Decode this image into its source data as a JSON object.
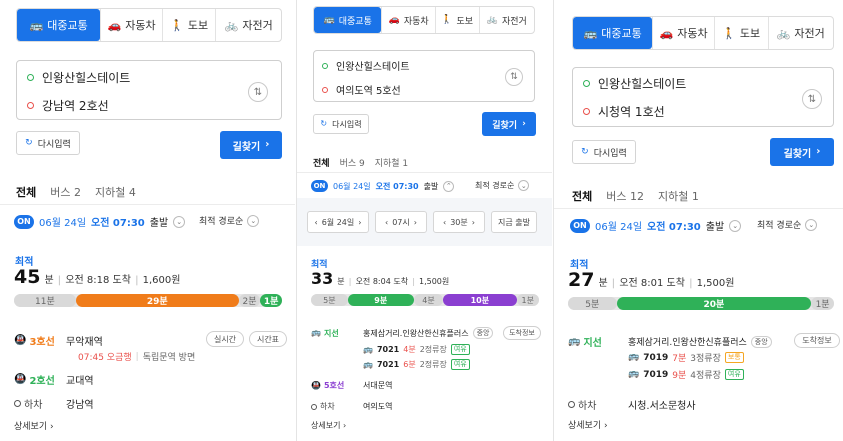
{
  "colors": {
    "accent": "#1a73e8",
    "line3": "#f07c1a",
    "line2": "#2fb158",
    "line5": "#8b3fd1",
    "bus_green": "#2fb158",
    "walk": "#d9d9d9"
  },
  "panels": [
    {
      "modes": [
        {
          "icon": "bus-icon",
          "glyph": "🚌",
          "label": "대중교통"
        },
        {
          "icon": "car-icon",
          "glyph": "🚗",
          "label": "자동차"
        },
        {
          "icon": "walk-icon",
          "glyph": "🚶",
          "label": "도보"
        },
        {
          "icon": "bike-icon",
          "glyph": "🚲",
          "label": "자전거"
        }
      ],
      "origin": "인왕산힐스테이트",
      "destination": "강남역 2호선",
      "reset_label": "다시입력",
      "search_label": "길찾기",
      "tabs": [
        "전체",
        "버스 2",
        "지하철 4"
      ],
      "on_badge": "ON",
      "date": "06월 24일",
      "time": "오전 07:30",
      "depart": "출발",
      "sort": "최적 경로순",
      "fastest": "최적",
      "minutes": "45",
      "unit": "분",
      "arrive": "오전 8:18 도착",
      "fare": "1,600원",
      "bar": [
        {
          "kind": "walk",
          "label": "11분",
          "value": 11
        },
        {
          "kind": "line3",
          "label": "29분",
          "value": 29
        },
        {
          "kind": "walk",
          "label": "2분",
          "value": 2
        },
        {
          "kind": "line2",
          "label": "1분",
          "value": 1
        }
      ],
      "steps": [
        {
          "tag": "3호선",
          "color": "line3",
          "stop": "무악재역",
          "buttons": [
            "실시간",
            "시간표"
          ]
        },
        {
          "tag": "2호선",
          "color": "line2",
          "stop": "교대역"
        },
        {
          "tag": "하차",
          "color": "",
          "stop": "강남역"
        }
      ],
      "step1_sub_time": "07:45 오금행",
      "step1_sub_dir": "독립문역 방면",
      "more": "상세보기"
    },
    {
      "modes": [
        {
          "icon": "bus-icon",
          "glyph": "🚌",
          "label": "대중교통"
        },
        {
          "icon": "car-icon",
          "glyph": "🚗",
          "label": "자동차"
        },
        {
          "icon": "walk-icon",
          "glyph": "🚶",
          "label": "도보"
        },
        {
          "icon": "bike-icon",
          "glyph": "🚲",
          "label": "자전거"
        }
      ],
      "origin": "인왕산힐스테이트",
      "destination": "여의도역 5호선",
      "reset_label": "다시입력",
      "search_label": "길찾기",
      "tabs": [
        "전체",
        "버스 9",
        "지하철 1"
      ],
      "on_badge": "ON",
      "date": "06월 24일",
      "time": "오전 07:30",
      "depart": "출발",
      "sort": "최적 경로순",
      "timebar": [
        "6월 24일",
        "07시",
        "30분"
      ],
      "now_depart": "지금 출발",
      "fastest": "최적",
      "minutes": "33",
      "unit": "분",
      "arrive": "오전 8:04 도착",
      "fare": "1,500원",
      "bar": [
        {
          "kind": "walk",
          "label": "5분",
          "value": 5
        },
        {
          "kind": "bus_green",
          "label": "9분",
          "value": 9
        },
        {
          "kind": "walk",
          "label": "4분",
          "value": 4
        },
        {
          "kind": "line5",
          "label": "10분",
          "value": 10
        },
        {
          "kind": "walk",
          "label": "1분",
          "value": 1
        }
      ],
      "bus_stop": "홍제삼거리.인왕산한신휴플러스",
      "stop_badge": "중앙",
      "stop_info": "도착정보",
      "buses": [
        {
          "no": "7021",
          "min": "4분",
          "stops": "2정류장",
          "status": "여유"
        },
        {
          "no": "7021",
          "min": "6분",
          "stops": "2정류장",
          "status": "여유"
        }
      ],
      "bus_tag": "지선",
      "steps2": [
        {
          "tag": "5호선",
          "color": "line5",
          "stop": "서대문역"
        },
        {
          "tag": "하차",
          "color": "",
          "stop": "여의도역"
        }
      ],
      "more": "상세보기"
    },
    {
      "modes": [
        {
          "icon": "bus-icon",
          "glyph": "🚌",
          "label": "대중교통"
        },
        {
          "icon": "car-icon",
          "glyph": "🚗",
          "label": "자동차"
        },
        {
          "icon": "walk-icon",
          "glyph": "🚶",
          "label": "도보"
        },
        {
          "icon": "bike-icon",
          "glyph": "🚲",
          "label": "자전거"
        }
      ],
      "origin": "인왕산힐스테이트",
      "destination": "시청역 1호선",
      "reset_label": "다시입력",
      "search_label": "길찾기",
      "tabs": [
        "전체",
        "버스 12",
        "지하철 1"
      ],
      "on_badge": "ON",
      "date": "06월 24일",
      "time": "오전 07:30",
      "depart": "출발",
      "sort": "최적 경로순",
      "fastest": "최적",
      "minutes": "27",
      "unit": "분",
      "arrive": "오전 8:01 도착",
      "fare": "1,500원",
      "bar": [
        {
          "kind": "walk",
          "label": "5분",
          "value": 5
        },
        {
          "kind": "bus_green",
          "label": "20분",
          "value": 20
        },
        {
          "kind": "walk",
          "label": "1분",
          "value": 1
        }
      ],
      "bus_tag": "지선",
      "bus_stop": "홍제삼거리.인왕산한신휴플러스",
      "stop_badge": "중앙",
      "stop_info": "도착정보",
      "buses": [
        {
          "no": "7019",
          "min": "7분",
          "stops": "3정류장",
          "status": "보통"
        },
        {
          "no": "7019",
          "min": "9분",
          "stops": "4정류장",
          "status": "여유"
        }
      ],
      "alight": "하차",
      "alight_stop": "시청.서소문청사",
      "more": "상세보기"
    }
  ]
}
